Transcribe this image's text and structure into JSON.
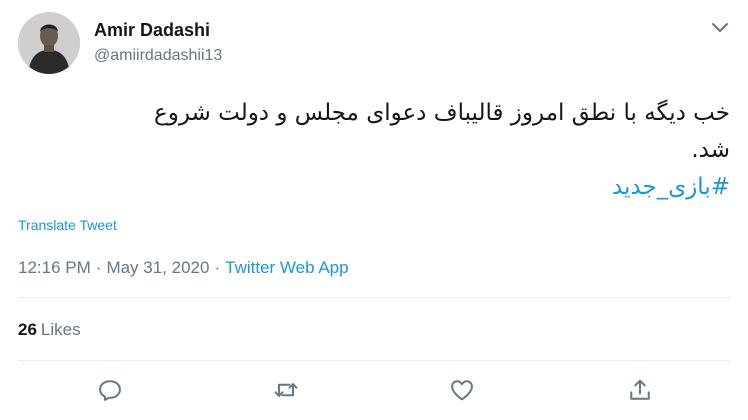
{
  "tweet": {
    "author_name": "Amir Dadashi",
    "author_handle": "@amiirdadashii13",
    "text_line1": "خب دیگه با نطق امروز قالیباف دعوای مجلس و دولت شروع",
    "text_line2": "شد.",
    "hashtag": "#بازی_جدید",
    "translate_label": "Translate Tweet",
    "time": "12:16 PM",
    "separator": "·",
    "date": "May 31, 2020",
    "source": "Twitter Web App",
    "likes_count": "26",
    "likes_label": "Likes"
  },
  "icons": {
    "menu": "chevron-down-icon",
    "reply": "reply-icon",
    "retweet": "retweet-icon",
    "like": "heart-icon",
    "share": "share-icon"
  },
  "colors": {
    "accent": "#1b95e0",
    "secondary_text": "#657786",
    "primary_text": "#14171a",
    "divider": "#e6ecf0"
  }
}
